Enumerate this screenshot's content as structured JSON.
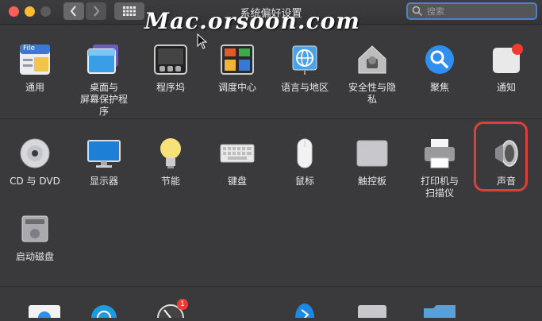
{
  "window": {
    "title": "系统偏好设置",
    "search_placeholder": "搜索"
  },
  "watermark": "Mac.orsoon.com",
  "row1": [
    {
      "label": "通用",
      "icon": "general-icon",
      "icon_text": "File"
    },
    {
      "label": "桌面与\n屏幕保护程序",
      "icon": "desktop-screensaver-icon"
    },
    {
      "label": "程序坞",
      "icon": "dock-icon"
    },
    {
      "label": "调度中心",
      "icon": "mission-control-icon"
    },
    {
      "label": "语言与地区",
      "icon": "language-region-icon"
    },
    {
      "label": "安全性与隐私",
      "icon": "security-privacy-icon"
    },
    {
      "label": "聚焦",
      "icon": "spotlight-icon"
    },
    {
      "label": "通知",
      "icon": "notifications-icon"
    }
  ],
  "row2": [
    {
      "label": "CD 与 DVD",
      "icon": "cd-dvd-icon"
    },
    {
      "label": "显示器",
      "icon": "displays-icon"
    },
    {
      "label": "节能",
      "icon": "energy-saver-icon"
    },
    {
      "label": "键盘",
      "icon": "keyboard-icon"
    },
    {
      "label": "鼠标",
      "icon": "mouse-icon"
    },
    {
      "label": "触控板",
      "icon": "trackpad-icon"
    },
    {
      "label": "打印机与\n扫描仪",
      "icon": "printers-scanners-icon"
    },
    {
      "label": "声音",
      "icon": "sound-icon"
    }
  ],
  "row3": [
    {
      "label": "启动磁盘",
      "icon": "startup-disk-icon"
    }
  ],
  "badges": {
    "software_update": "1"
  },
  "colors": {
    "background": "#3a3a3c",
    "highlight": "#d9423a",
    "search_focus": "#4b80d8"
  }
}
